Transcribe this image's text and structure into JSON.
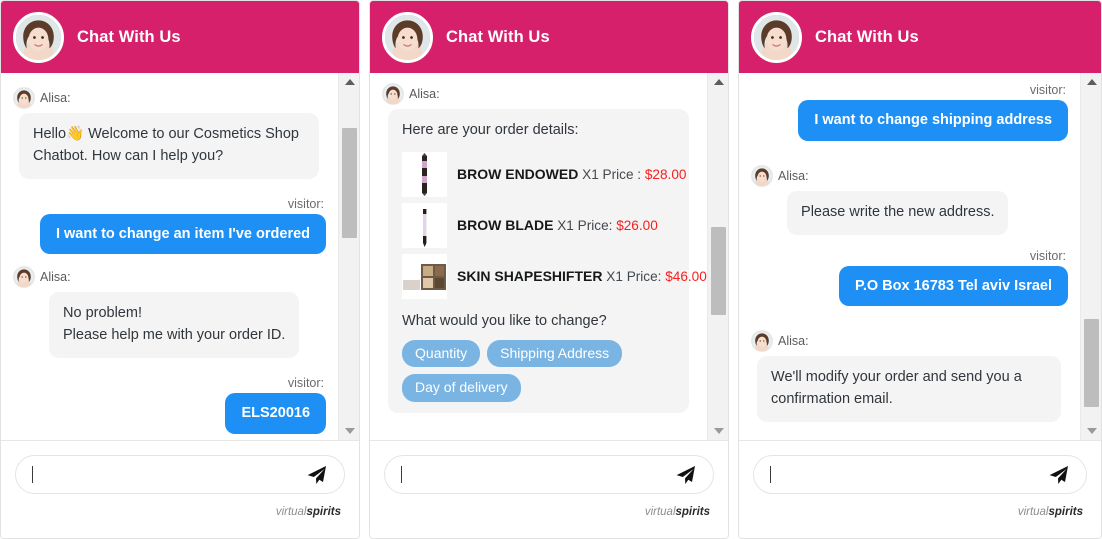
{
  "brand": {
    "part1": "virtual",
    "part2": "spirits"
  },
  "composer": {
    "placeholder": "",
    "value": "",
    "send_icon": "paper-plane-icon"
  },
  "panels": [
    {
      "header": {
        "title": "Chat With Us",
        "avatar": "agent-avatar"
      },
      "scroll": {
        "thumb_top_pct": 10,
        "thumb_height_pct": 30
      },
      "messages": [
        {
          "type": "bot",
          "speaker": "Alisa:",
          "text": "Hello👋 Welcome to our Cosmetics Shop Chatbot. How can I help you?"
        },
        {
          "type": "user",
          "label": "visitor:",
          "text": "I want to change an item I've ordered"
        },
        {
          "type": "bot",
          "speaker": "Alisa:",
          "text": "No problem!\nPlease help me with your order ID."
        },
        {
          "type": "user",
          "label": "visitor:",
          "text": "ELS20016"
        }
      ]
    },
    {
      "header": {
        "title": "Chat With Us",
        "avatar": "agent-avatar"
      },
      "scroll": {
        "thumb_top_pct": 37,
        "thumb_height_pct": 24
      },
      "order": {
        "speaker": "Alisa:",
        "intro": "Here are your order details:",
        "items": [
          {
            "thumb": "brow-pencil-dark-icon",
            "name": "BROW ENDOWED",
            "qty": "X1",
            "price_label": "Price :",
            "price": "$28.00"
          },
          {
            "thumb": "brow-pencil-light-icon",
            "name": "BROW BLADE",
            "qty": "X1",
            "price_label": "Price:",
            "price": "$26.00"
          },
          {
            "thumb": "eyeshadow-palette-icon",
            "name": "SKIN SHAPESHIFTER",
            "qty": "X1",
            "price_label": "Price:",
            "price": "$46.00"
          }
        ],
        "prompt": "What would you like to change?",
        "choices": [
          "Quantity",
          "Shipping Address",
          "Day of delivery"
        ]
      }
    },
    {
      "header": {
        "title": "Chat With Us",
        "avatar": "agent-avatar"
      },
      "scroll": {
        "thumb_top_pct": 62,
        "thumb_height_pct": 24
      },
      "messages": [
        {
          "type": "user",
          "label": "visitor:",
          "text": "I want to change shipping address"
        },
        {
          "type": "bot",
          "speaker": "Alisa:",
          "text": "Please write the new address."
        },
        {
          "type": "user",
          "label": "visitor:",
          "text": "P.O Box 16783 Tel aviv Israel"
        },
        {
          "type": "bot",
          "speaker": "Alisa:",
          "text": "We'll modify your order and send you a confirmation email."
        }
      ]
    }
  ],
  "colors": {
    "header_pink": "#d6206b",
    "user_bubble_blue": "#1e90f5",
    "bot_bubble_gray": "#f4f4f4",
    "price_red": "#f72020",
    "chip_blue": "#79b4e3"
  }
}
